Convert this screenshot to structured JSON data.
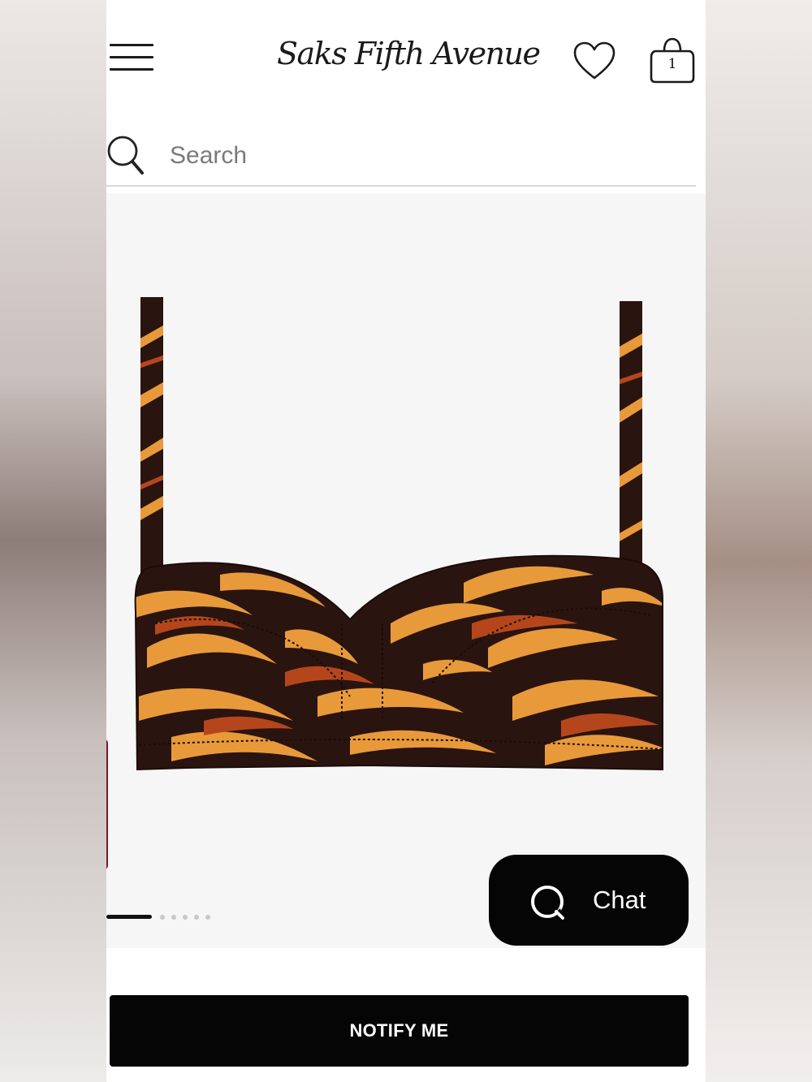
{
  "header": {
    "brand": "Saks Fifth Avenue",
    "bag_count": "1"
  },
  "search": {
    "placeholder": "Search"
  },
  "gallery": {
    "slide_count": 6,
    "active_slide": 1
  },
  "chat": {
    "label": "Chat"
  },
  "cta": {
    "label": "NOTIFY ME"
  },
  "colors": {
    "print_dark": "#2a1410",
    "print_orange": "#e89a3a",
    "print_rust": "#b5461c",
    "button": "#050505"
  },
  "icons": [
    "menu-icon",
    "heart-icon",
    "shopping-bag-icon",
    "search-icon",
    "chat-bubble-icon"
  ]
}
